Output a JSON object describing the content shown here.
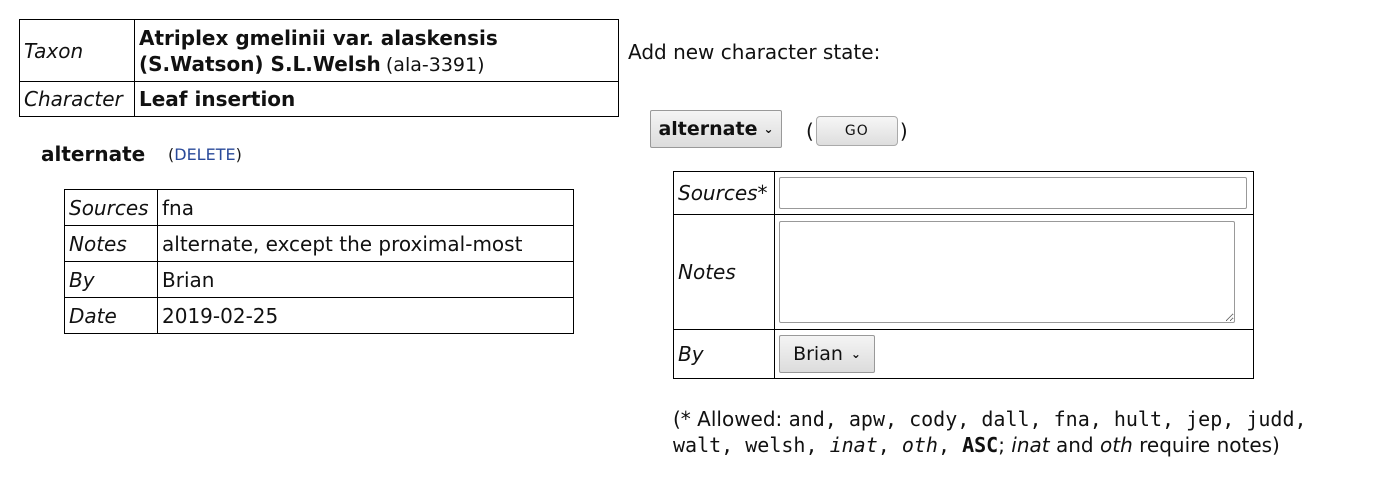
{
  "taxon_table": {
    "taxon_label": "Taxon",
    "taxon_name": "Atriplex gmelinii var. alaskensis (S.Watson) S.L.Welsh",
    "taxon_id": "(ala-3391)",
    "character_label": "Character",
    "character_name": "Leaf insertion"
  },
  "state": {
    "name": "alternate",
    "delete_open": "(",
    "delete_label": "DELETE",
    "delete_close": ")",
    "details": {
      "sources_label": "Sources",
      "sources": "fna",
      "notes_label": "Notes",
      "notes": "alternate, except the proximal-most",
      "by_label": "By",
      "by": "Brian",
      "date_label": "Date",
      "date": "2019-02-25"
    }
  },
  "add_form": {
    "title": "Add new character state:",
    "state_select_value": "alternate",
    "go_open": "(",
    "go_label": "GO",
    "go_close": ")",
    "sources_label": "Sources*",
    "sources_value": "",
    "notes_label": "Notes",
    "notes_value": "",
    "by_label": "By",
    "by_value": "Brian",
    "allowed": {
      "prefix": "(* Allowed: ",
      "codes": [
        "and",
        "apw",
        "cody",
        "dall",
        "fna",
        "hult",
        "jep",
        "judd",
        "walt",
        "welsh"
      ],
      "italic_codes": [
        "inat",
        "oth"
      ],
      "bold_code": "ASC",
      "suffix_1": "; ",
      "suffix_inat": "inat",
      "suffix_and": " and ",
      "suffix_oth": "oth",
      "suffix_end": " require notes)"
    }
  }
}
